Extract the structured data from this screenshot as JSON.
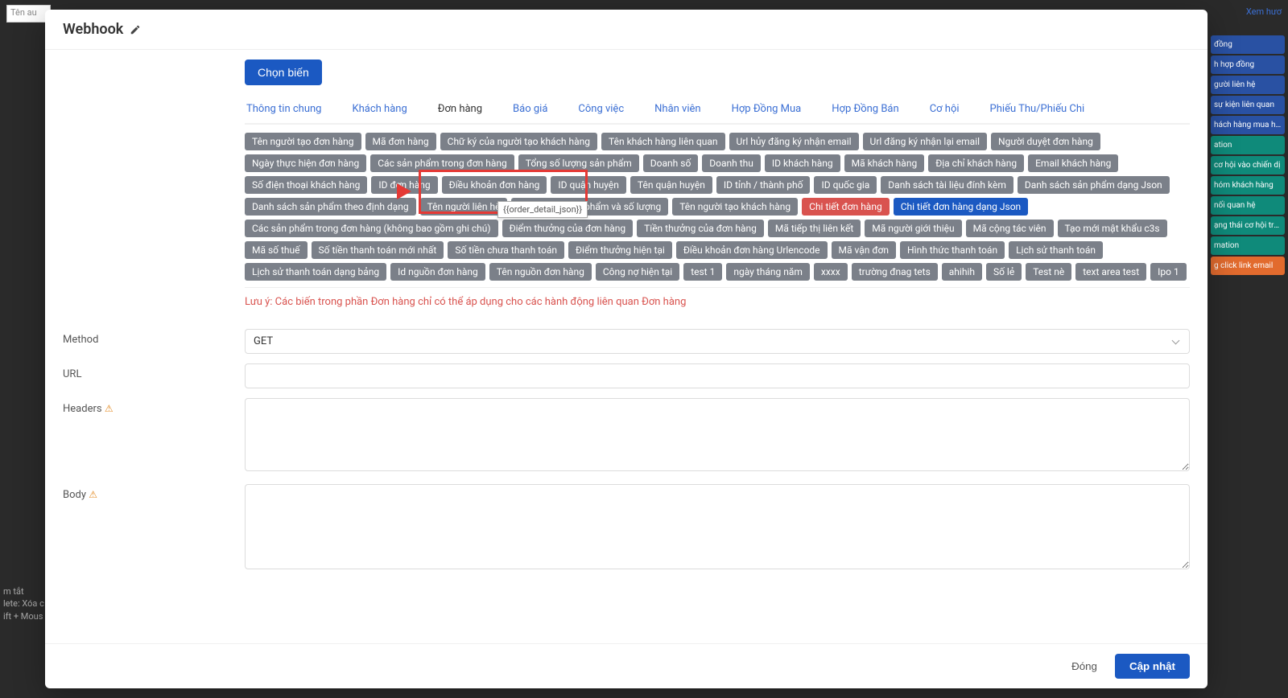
{
  "bg": {
    "input_ph": "Tên au",
    "view_tut": "Xem hươ",
    "tips": [
      "m tắt",
      "lete: Xóa c",
      "ift + Mous"
    ],
    "right_buttons": [
      {
        "cls": "bg-blue",
        "label": "đồng"
      },
      {
        "cls": "bg-blue",
        "label": "h hợp đồng"
      },
      {
        "cls": "bg-blue",
        "label": "gười liên hệ"
      },
      {
        "cls": "bg-blue",
        "label": "sự kiện liên quan"
      },
      {
        "cls": "bg-blue",
        "label": "hách hàng mua hàn"
      },
      {
        "cls": "bg-teal",
        "label": "ation"
      },
      {
        "cls": "bg-teal",
        "label": "cơ hội vào chiến dị"
      },
      {
        "cls": "bg-teal",
        "label": "hóm khách hàng"
      },
      {
        "cls": "bg-teal",
        "label": "nối quan hệ"
      },
      {
        "cls": "bg-teal",
        "label": "ạng thái cơ hội tron"
      },
      {
        "cls": "bg-teal",
        "label": "mation"
      },
      {
        "cls": "bg-orange",
        "label": "g click link email"
      }
    ]
  },
  "modal": {
    "title": "Webhook",
    "choose_btn": "Chọn biến",
    "tabs": [
      "Thông tin chung",
      "Khách hàng",
      "Đơn hàng",
      "Báo giá",
      "Công việc",
      "Nhân viên",
      "Hợp Đồng Mua",
      "Hợp Đồng Bán",
      "Cơ hội",
      "Phiếu Thu/Phiếu Chi"
    ],
    "active_tab": 2,
    "chips": [
      "Tên người tạo đơn hàng",
      "Mã đơn hàng",
      "Chữ ký của người tạo khách hàng",
      "Tên khách hàng liên quan",
      "Url hủy đăng ký nhận email",
      "Url đăng ký nhận lại email",
      "Người duyệt đơn hàng",
      "Ngày thực hiện đơn hàng",
      "Các sản phẩm trong đơn hàng",
      "Tổng số lượng sản phẩm",
      "Doanh số",
      "Doanh thu",
      "ID khách hàng",
      "Mã khách hàng",
      "Địa chỉ khách hàng",
      "Email khách hàng",
      "Số điện thoại khách hàng",
      "ID đơn hàng",
      "Điều khoản đơn hàng",
      "ID quận huyện",
      "Tên quận huyện",
      "ID tỉnh / thành phố",
      "ID quốc gia",
      "Danh sách tài liệu đính kèm",
      "Danh sách sản phẩm dạng Json",
      "Danh sách sản phẩm theo định dạng",
      "Tên người liên hệ",
      "Danh sách sản phẩm và số lượng",
      "Tên người tạo khách hàng",
      "Chi tiết đơn hàng",
      "Chi tiết đơn hàng dạng Json",
      "Các sản phẩm trong đơn hàng (không bao gồm ghi chú)",
      "Điểm thưởng của đơn hàng",
      "Tiền thưởng của đơn hàng",
      "Mã tiếp thị liên kết",
      "Mã người giới thiệu",
      "Mã cộng tác viên",
      "Tạo mới mật khẩu c3s",
      "Mã số thuế",
      "Số tiền thanh toán mới nhất",
      "Số tiền chưa thanh toán",
      "Điểm thưởng hiện tại",
      "Điều khoản đơn hàng Urlencode",
      "Mã vận đơn",
      "Hình thức thanh toán",
      "Lịch sử thanh toán",
      "Lịch sử thanh toán dạng bảng",
      "Id nguồn đơn hàng",
      "Tên nguồn đơn hàng",
      "Công nợ hiện tại",
      "test 1",
      "ngày tháng năm",
      "xxxx",
      "trường đnag tets",
      "ahihih",
      "Số lẻ",
      "Test nè",
      "text area test",
      "Ipo 1"
    ],
    "hover_chip": 29,
    "active_chip": 30,
    "tooltip": "{{order_detail_json}}",
    "note": "Lưu ý: Các biến trong phần Đơn hàng chỉ có thể áp dụng cho các hành động liên quan Đơn hàng",
    "fields": {
      "method_label": "Method",
      "method_value": "GET",
      "url_label": "URL",
      "headers_label": "Headers",
      "body_label": "Body"
    },
    "footer": {
      "close": "Đóng",
      "submit": "Cập nhật"
    }
  }
}
